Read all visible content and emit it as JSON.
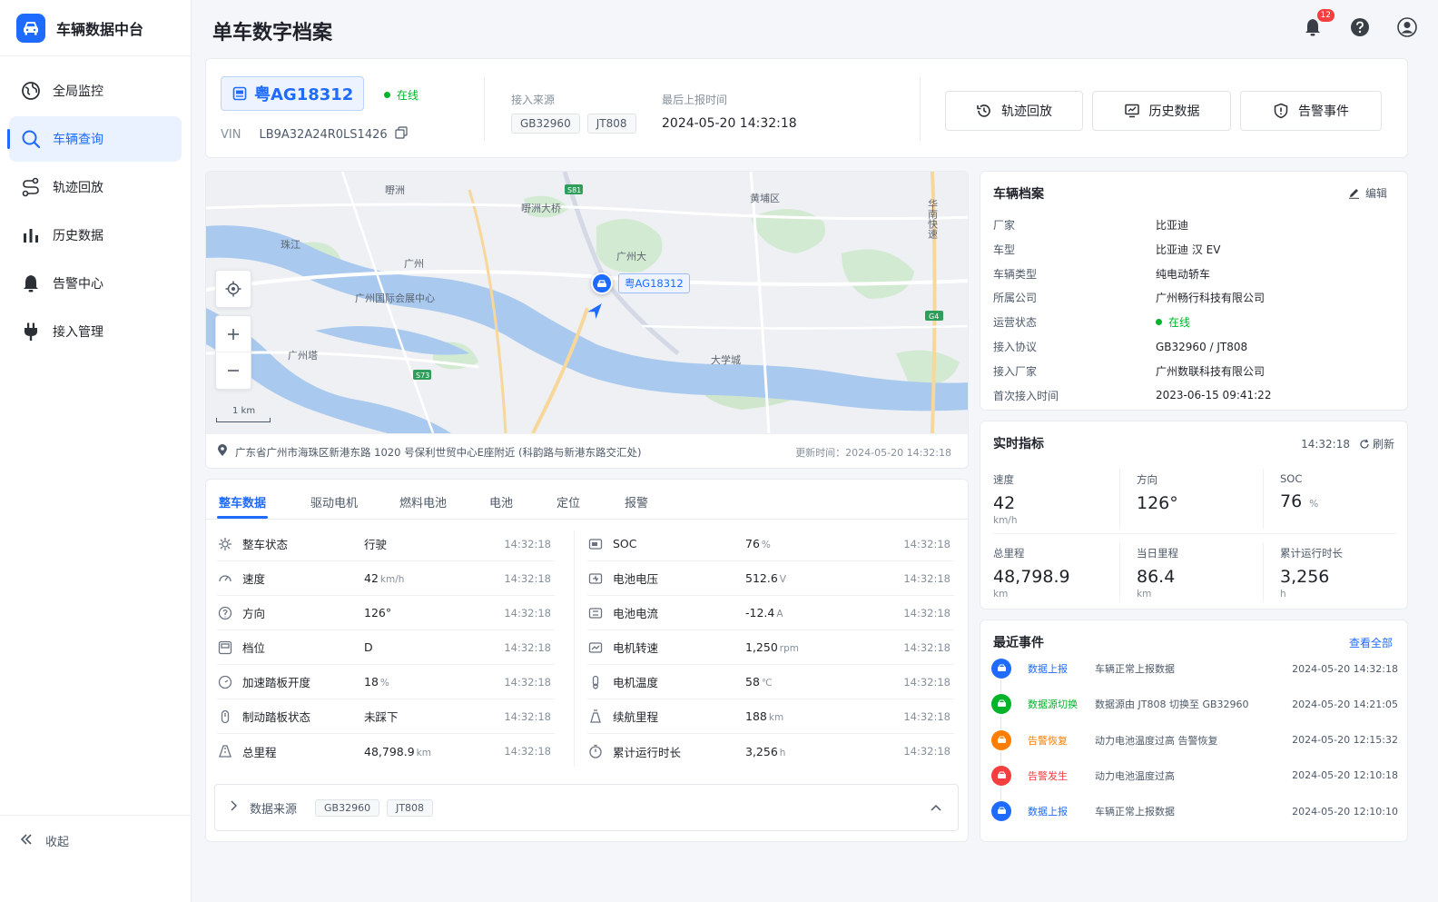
{
  "app": {
    "title": "车辆数据中台"
  },
  "sidebar": {
    "items": [
      {
        "label": "全局监控",
        "icon": "globe-icon"
      },
      {
        "label": "车辆查询",
        "icon": "search-icon",
        "active": true
      },
      {
        "label": "轨迹回放",
        "icon": "route-icon"
      },
      {
        "label": "历史数据",
        "icon": "bar-chart-icon"
      },
      {
        "label": "告警中心",
        "icon": "bell-icon"
      },
      {
        "label": "接入管理",
        "icon": "plug-icon"
      }
    ],
    "collapse_label": "收起"
  },
  "header": {
    "title": "单车数字档案",
    "notification_count": "12"
  },
  "vehicle": {
    "plate": "粤AG18312",
    "status": "在线",
    "vin_label": "VIN",
    "vin": "LB9A32A24R0LS1426",
    "source_label": "接入来源",
    "sources": [
      "GB32960",
      "JT808"
    ],
    "last_report_label": "最后上报时间",
    "last_report": "2024-05-20 14:32:18"
  },
  "actions": {
    "track": "轨迹回放",
    "history": "历史数据",
    "alarm": "告警事件"
  },
  "map": {
    "labels": {
      "a": "嘢洲",
      "b": "嘢洲大桥",
      "c": "黄埔区",
      "d": "珠江",
      "e": "广州国际会展中心",
      "f": "广州塔",
      "g": "广州大",
      "h": "大学城",
      "i": "华南快速",
      "j": "广州",
      "k": "S81",
      "l": "G4",
      "m": "S73"
    },
    "marker_plate": "粤AG18312",
    "scale": "1 km",
    "address": "广东省广州市海珠区新港东路 1020 号保利世贸中心E座附近 (科韵路与新港东路交汇处)",
    "updated_label": "更新时间：",
    "updated": "2024-05-20   14:32:18"
  },
  "tabs": [
    "整车数据",
    "驱动电机",
    "燃料电池",
    "电池",
    "定位",
    "报警"
  ],
  "data_left": [
    {
      "label": "整车状态",
      "value": "行驶",
      "unit": "",
      "time": "14:32:18",
      "icon": "car-status-icon"
    },
    {
      "label": "速度",
      "value": "42",
      "unit": "km/h",
      "time": "14:32:18",
      "icon": "speedometer-icon"
    },
    {
      "label": "方向",
      "value": "126°",
      "unit": "",
      "time": "14:32:18",
      "icon": "compass-icon"
    },
    {
      "label": "档位",
      "value": "D",
      "unit": "",
      "time": "14:32:18",
      "icon": "gear-shift-icon"
    },
    {
      "label": "加速踏板开度",
      "value": "18",
      "unit": "%",
      "time": "14:32:18",
      "icon": "gauge-icon"
    },
    {
      "label": "制动踏板状态",
      "value": "未踩下",
      "unit": "",
      "time": "14:32:18",
      "icon": "brake-icon"
    },
    {
      "label": "总里程",
      "value": "48,798.9",
      "unit": "km",
      "time": "14:32:18",
      "icon": "road-icon"
    }
  ],
  "data_right": [
    {
      "label": "SOC",
      "value": "76",
      "unit": "%",
      "time": "14:32:18",
      "icon": "battery-icon"
    },
    {
      "label": "电池电压",
      "value": "512.6",
      "unit": "V",
      "time": "14:32:18",
      "icon": "voltage-icon"
    },
    {
      "label": "电池电流",
      "value": "-12.4",
      "unit": "A",
      "time": "14:32:18",
      "icon": "current-icon"
    },
    {
      "label": "电机转速",
      "value": "1,250",
      "unit": "rpm",
      "time": "14:32:18",
      "icon": "motor-icon"
    },
    {
      "label": "电机温度",
      "value": "58",
      "unit": "℃",
      "time": "14:32:18",
      "icon": "thermometer-icon"
    },
    {
      "label": "续航里程",
      "value": "188",
      "unit": "km",
      "time": "14:32:18",
      "icon": "range-icon"
    },
    {
      "label": "累计运行时长",
      "value": "3,256",
      "unit": "h",
      "time": "14:32:18",
      "icon": "stopwatch-icon"
    }
  ],
  "data_source": {
    "label": "数据来源",
    "tags": [
      "GB32960",
      "JT808"
    ]
  },
  "profile": {
    "title": "车辆档案",
    "edit": "编辑",
    "rows": [
      {
        "label": "厂家",
        "value": "比亚迪"
      },
      {
        "label": "车型",
        "value": "比亚迪 汉 EV"
      },
      {
        "label": "车辆类型",
        "value": "纯电动轿车"
      },
      {
        "label": "所属公司",
        "value": "广州畅行科技有限公司"
      },
      {
        "label": "运营状态",
        "value": "在线"
      },
      {
        "label": "接入协议",
        "value": "GB32960 / JT808"
      },
      {
        "label": "接入厂家",
        "value": "广州数联科技有限公司"
      },
      {
        "label": "首次接入时间",
        "value": "2023-06-15 09:41:22"
      }
    ]
  },
  "realtime": {
    "title": "实时指标",
    "time": "14:32:18",
    "refresh": "刷新",
    "metrics": [
      {
        "label": "速度",
        "value": "42",
        "unit": "km/h"
      },
      {
        "label": "方向",
        "value": "126°",
        "unit": ""
      },
      {
        "label": "SOC",
        "value": "76",
        "unit": "%"
      },
      {
        "label": "总里程",
        "value": "48,798.9",
        "unit": "km"
      },
      {
        "label": "当日里程",
        "value": "86.4",
        "unit": "km"
      },
      {
        "label": "累计运行时长",
        "value": "3,256",
        "unit": "h"
      }
    ]
  },
  "events": {
    "title": "最近事件",
    "view_all": "查看全部",
    "items": [
      {
        "type": "数据上报",
        "desc": "车辆正常上报数据",
        "time": "2024-05-20  14:32:18",
        "color": "#1f6bff"
      },
      {
        "type": "数据源切换",
        "desc": "数据源由 JT808 切换至 GB32960",
        "time": "2024-05-20  14:21:05",
        "color": "#00b42a"
      },
      {
        "type": "告警恢复",
        "desc": "动力电池温度过高 告警恢复",
        "time": "2024-05-20  12:15:32",
        "color": "#ff7d00"
      },
      {
        "type": "告警发生",
        "desc": "动力电池温度过高",
        "time": "2024-05-20  12:10:18",
        "color": "#f53f3f"
      },
      {
        "type": "数据上报",
        "desc": "车辆正常上报数据",
        "time": "2024-05-20  12:10:10",
        "color": "#1f6bff"
      }
    ]
  },
  "colors": {
    "primary": "#1f6bff",
    "online": "#00b42a",
    "warning": "#ff7d00",
    "danger": "#f53f3f"
  }
}
